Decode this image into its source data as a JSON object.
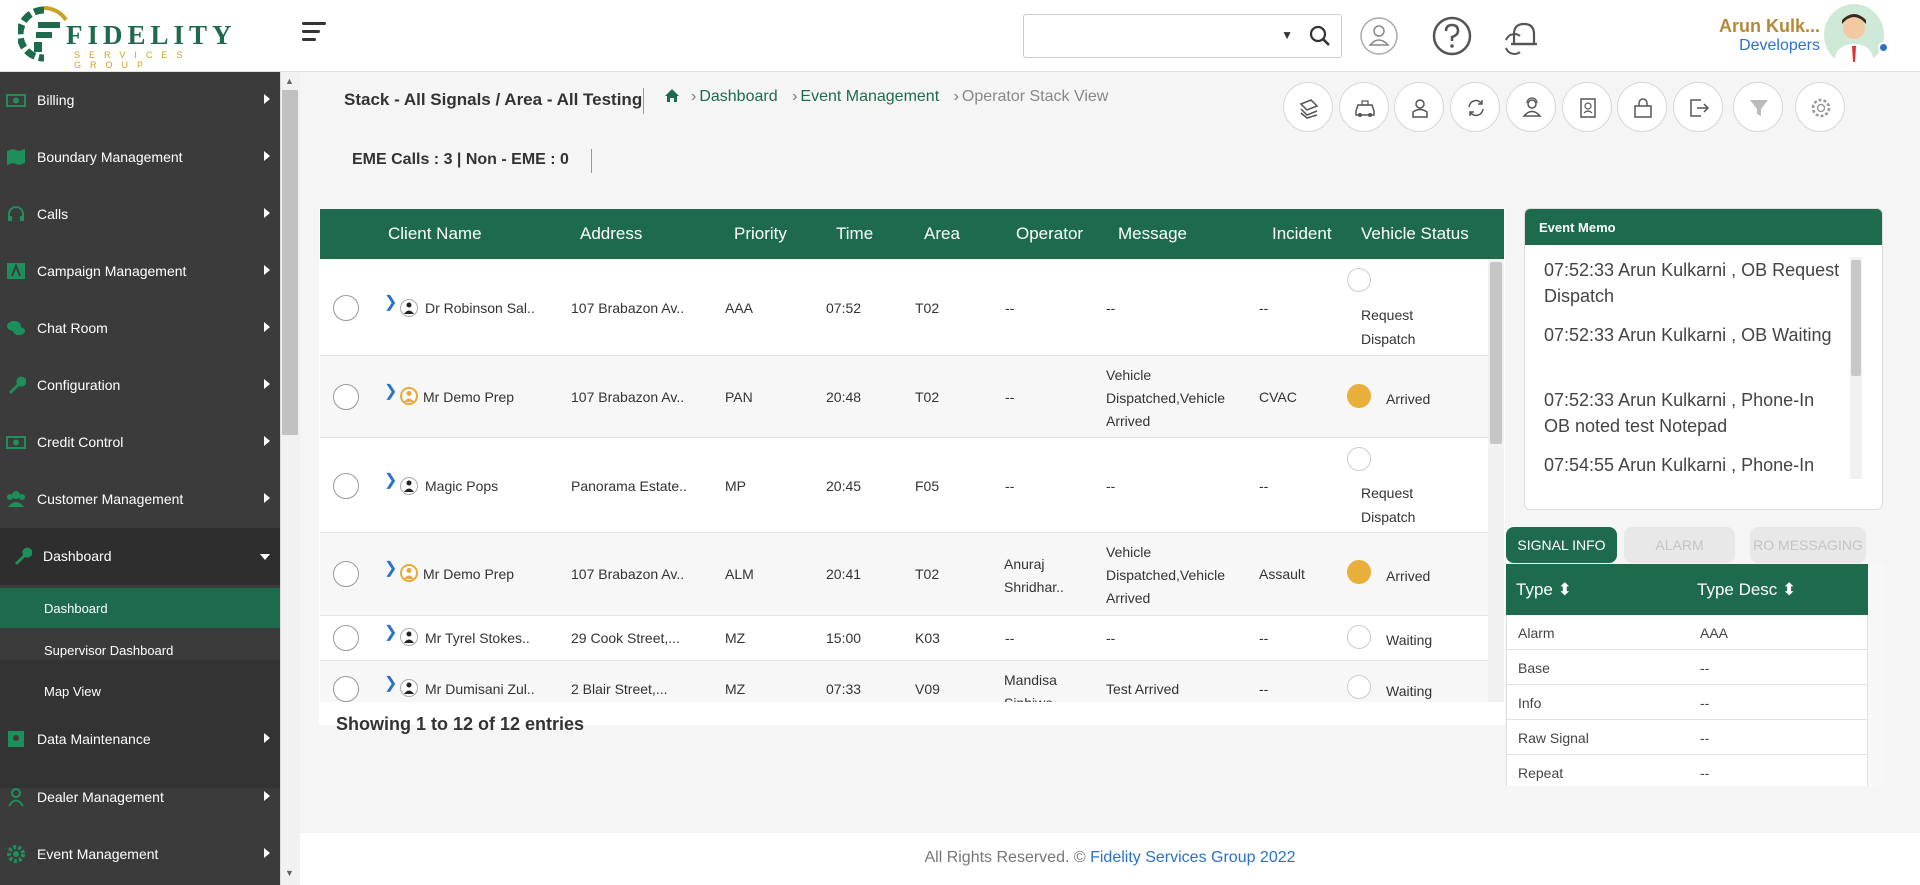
{
  "header": {
    "logo_text": "FIDELITY",
    "logo_sub": "SERVICES GROUP",
    "user_name": "Arun Kulk...",
    "user_role": "Developers"
  },
  "sidebar": {
    "items": [
      {
        "label": "Billing",
        "icon": "money-icon"
      },
      {
        "label": "Boundary Management",
        "icon": "map-icon"
      },
      {
        "label": "Calls",
        "icon": "headset-icon"
      },
      {
        "label": "Campaign Management",
        "icon": "campaign-icon"
      },
      {
        "label": "Chat Room",
        "icon": "chat-icon"
      },
      {
        "label": "Configuration",
        "icon": "wrench-icon"
      },
      {
        "label": "Credit Control",
        "icon": "money-icon"
      },
      {
        "label": "Customer Management",
        "icon": "users-icon"
      },
      {
        "label": "Dashboard",
        "icon": "wrench-icon"
      },
      {
        "label": "Data Maintenance",
        "icon": "data-icon"
      },
      {
        "label": "Dealer Management",
        "icon": "user-icon"
      },
      {
        "label": "Event Management",
        "icon": "gear-icon"
      }
    ],
    "dashboard_sub": [
      "Dashboard",
      "Supervisor Dashboard",
      "Map View"
    ]
  },
  "main": {
    "stack_title": "Stack - All Signals / Area - All Testing",
    "breadcrumb": [
      "Dashboard",
      "Event Management",
      "Operator Stack View"
    ],
    "eme_text": "EME Calls : 3 | Non - EME : 0",
    "showing": "Showing 1 to 12 of 12 entries"
  },
  "table": {
    "columns": [
      "Client Name",
      "Address",
      "Priority",
      "Time",
      "Area",
      "Operator",
      "Message",
      "Incident",
      "Vehicle Status"
    ],
    "rows": [
      {
        "client": "Dr Robinson Sal..",
        "address": "107 Brabazon Av..",
        "priority": "AAA",
        "time": "07:52",
        "area": "T02",
        "operator": "--",
        "message": "--",
        "incident": "--",
        "status": "Request Dispatch"
      },
      {
        "client": "Mr Demo Prep",
        "address": "107 Brabazon Av..",
        "priority": "PAN",
        "time": "20:48",
        "area": "T02",
        "operator": "--",
        "message": "Vehicle Dispatched,Vehicle Arrived",
        "incident": "CVAC",
        "status": "Arrived"
      },
      {
        "client": "Magic Pops",
        "address": "Panorama Estate..",
        "priority": "MP",
        "time": "20:45",
        "area": "F05",
        "operator": "--",
        "message": "--",
        "incident": "--",
        "status": "Request Dispatch"
      },
      {
        "client": "Mr Demo Prep",
        "address": "107 Brabazon Av..",
        "priority": "ALM",
        "time": "20:41",
        "area": "T02",
        "operator": "Anuraj Shridhar..",
        "message": "Vehicle Dispatched,Vehicle Arrived",
        "incident": "Assault",
        "status": "Arrived"
      },
      {
        "client": "Mr Tyrel Stokes..",
        "address": "29 Cook Street,...",
        "priority": "MZ",
        "time": "15:00",
        "area": "K03",
        "operator": "--",
        "message": "--",
        "incident": "--",
        "status": "Waiting"
      },
      {
        "client": "Mr Dumisani Zul..",
        "address": "2 Blair Street,...",
        "priority": "MZ",
        "time": "07:33",
        "area": "V09",
        "operator": "Mandisa Sinhiwe",
        "message": "Test Arrived",
        "incident": "--",
        "status": "Waiting"
      }
    ]
  },
  "memo": {
    "title": "Event Memo",
    "entries": [
      "07:52:33 Arun Kulkarni , OB Request Dispatch",
      "07:52:33 Arun Kulkarni , OB Waiting",
      "07:52:33 Arun Kulkarni , Phone-In OB noted test Notepad",
      "07:54:55 Arun Kulkarni , Phone-In"
    ]
  },
  "tabs": [
    "SIGNAL INFO",
    "ALARM",
    "RO MESSAGING"
  ],
  "signal": {
    "columns": [
      "Type",
      "Type Desc"
    ],
    "rows": [
      {
        "type": "Alarm",
        "desc": "AAA"
      },
      {
        "type": "Base",
        "desc": "--"
      },
      {
        "type": "Info",
        "desc": "--"
      },
      {
        "type": "Raw Signal",
        "desc": "--"
      },
      {
        "type": "Repeat",
        "desc": "--"
      }
    ]
  },
  "footer": {
    "text": "All Rights Reserved. © ",
    "link": "Fidelity Services Group 2022"
  },
  "colors": {
    "brand_green": "#1d6b4c",
    "gold": "#c9a227",
    "status_yellow": "#e8b03a",
    "link_blue": "#2a72c9"
  }
}
